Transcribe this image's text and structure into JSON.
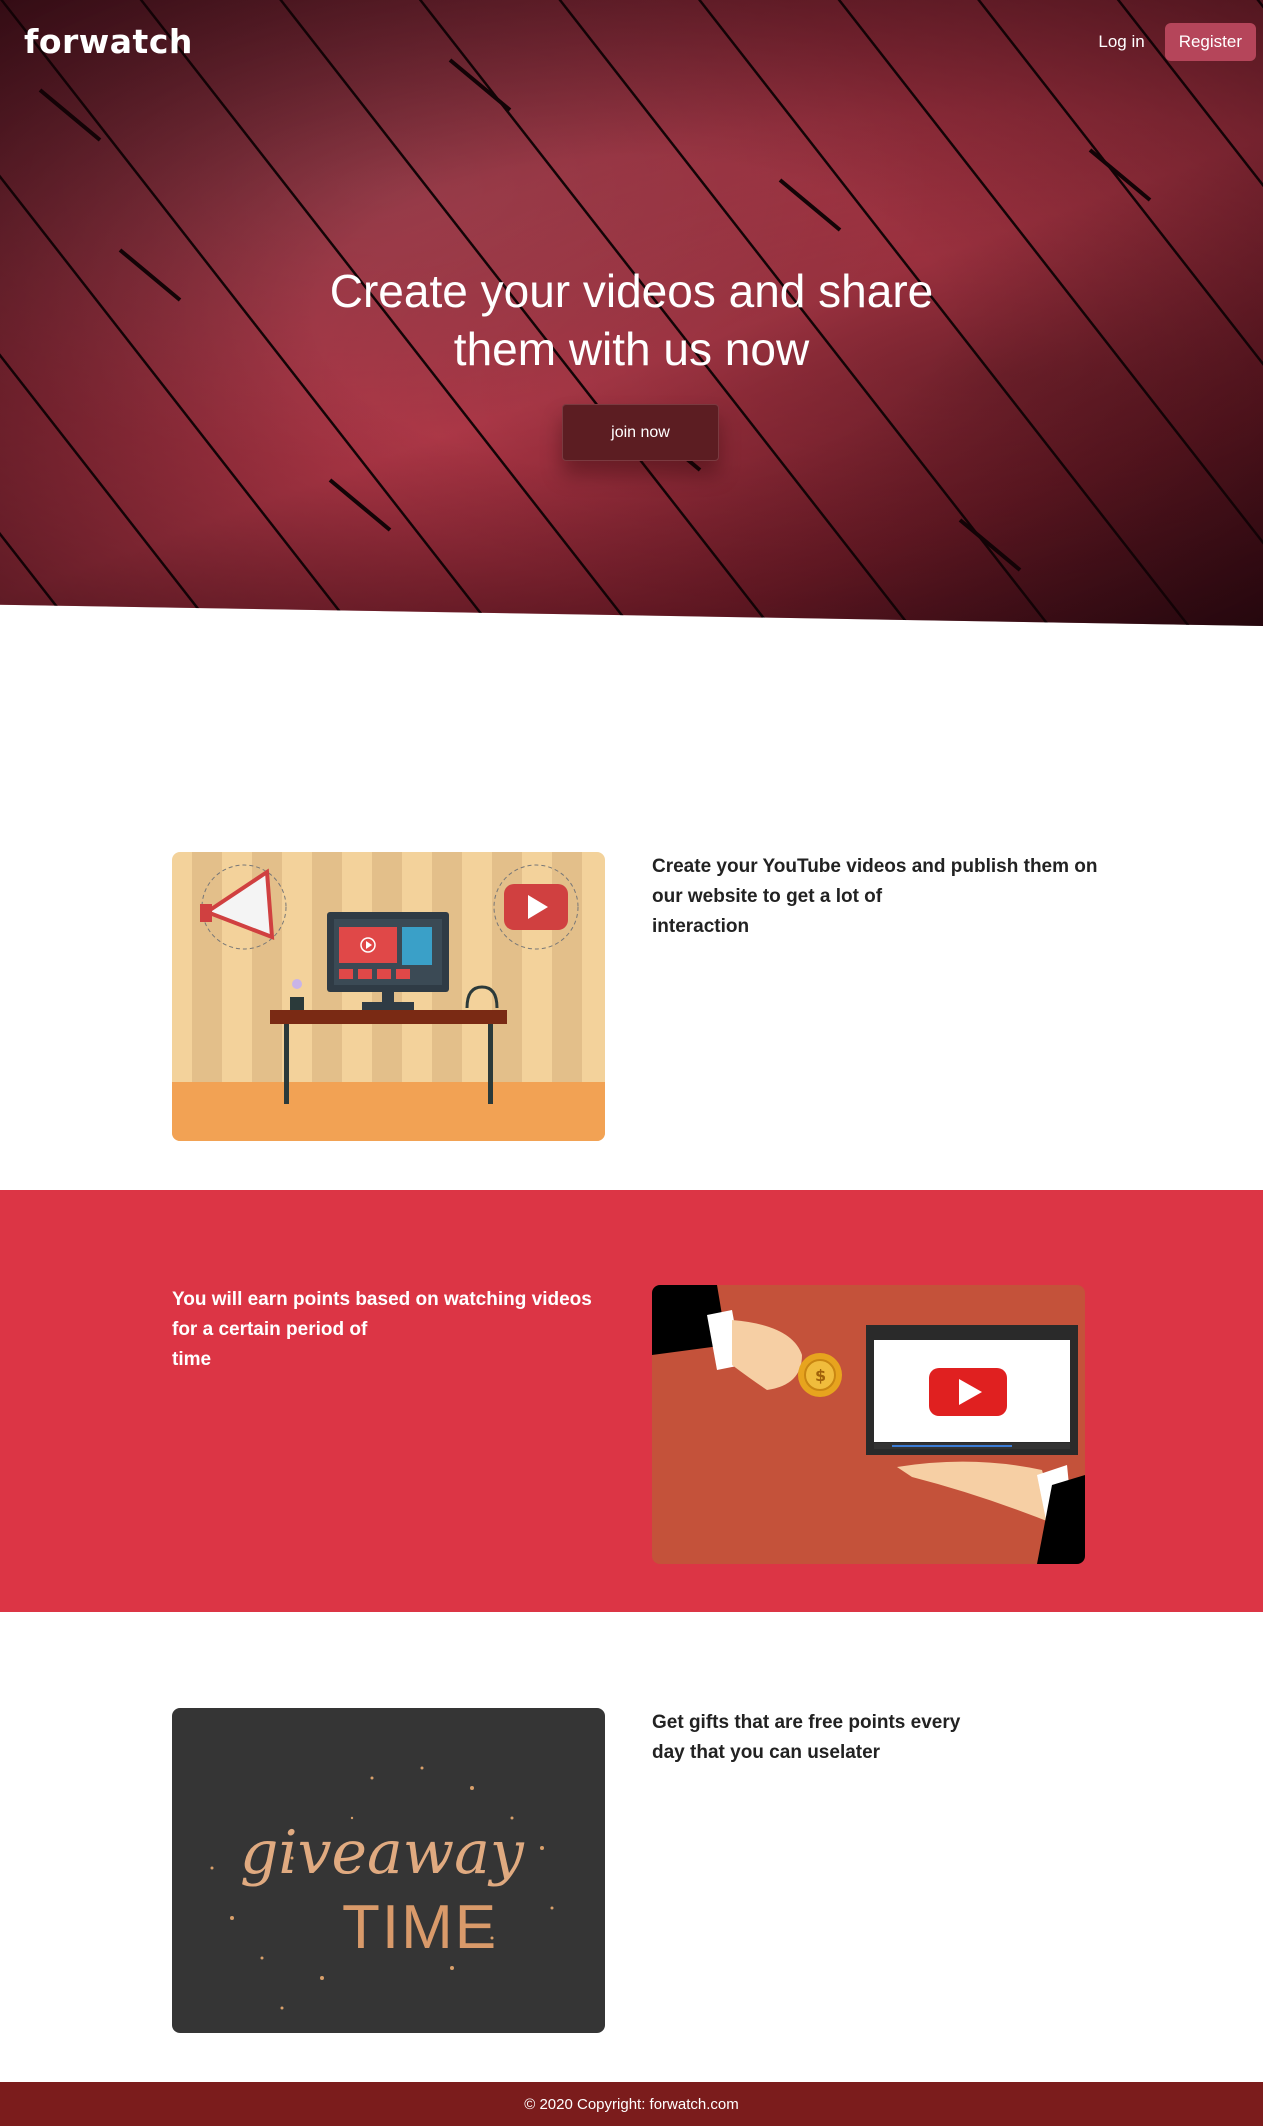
{
  "header": {
    "brand": "forwatch",
    "login_label": "Log in",
    "register_label": "Register"
  },
  "hero": {
    "title_line1": "Create your videos and share",
    "title_line2": "them with us now",
    "cta_label": "join now"
  },
  "features": [
    {
      "lines": [
        "Create your YouTube videos and publish them on",
        "our website to get a lot of",
        "interaction"
      ],
      "image_icon": "desk-computer-megaphone-illustration"
    },
    {
      "lines": [
        "You will earn points based on watching videos",
        "for a certain period of",
        "time"
      ],
      "image_icon": "hands-coin-video-illustration"
    },
    {
      "lines": [
        "Get gifts that are free points every",
        "day that you can uselater"
      ],
      "image_icon": "giveaway-time-illustration",
      "image_text_1": "giveaway",
      "image_text_2": "TIME"
    }
  ],
  "footer": {
    "copyright": "© 2020 Copyright: forwatch.com"
  },
  "colors": {
    "accent_red": "#dc3545",
    "footer_bg": "#7b1c1c",
    "register_bg": "#b5455a",
    "cta_bg": "#5c1d22"
  }
}
